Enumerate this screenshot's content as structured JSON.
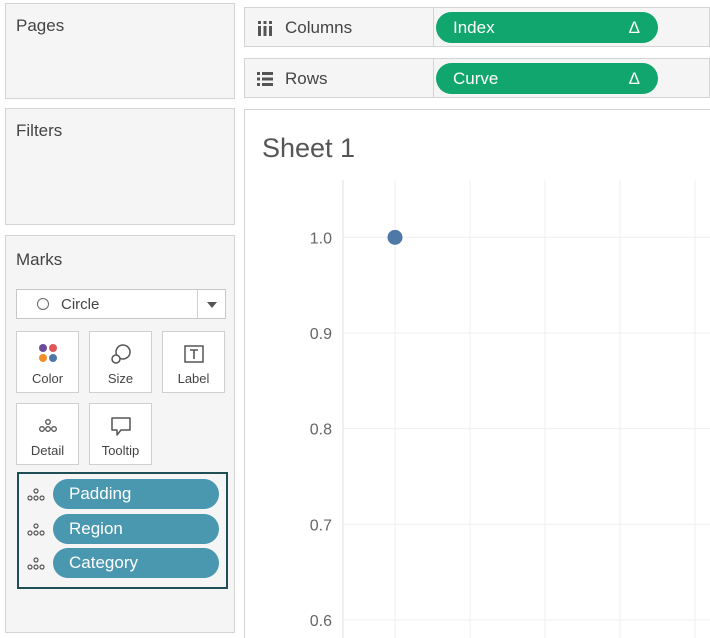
{
  "cards": {
    "pages": "Pages",
    "filters": "Filters",
    "marks": "Marks"
  },
  "marks": {
    "type": "Circle",
    "buttons": {
      "color": "Color",
      "size": "Size",
      "label": "Label",
      "detail": "Detail",
      "tooltip": "Tooltip"
    },
    "detail_fields": [
      "Padding",
      "Region",
      "Category"
    ]
  },
  "shelves": {
    "columns": {
      "label": "Columns",
      "pill": "Index",
      "delta": "Δ"
    },
    "rows": {
      "label": "Rows",
      "pill": "Curve",
      "delta": "Δ"
    }
  },
  "sheet": {
    "title": "Sheet 1"
  },
  "colors": {
    "dimension_pill": "#4a97b0",
    "measure_pill": "#10a66d",
    "mark": "#4e79a7",
    "highlight_border": "#1f4e55"
  },
  "chart_data": {
    "type": "scatter",
    "title": "Sheet 1",
    "xlabel": "",
    "ylabel": "",
    "y_ticks": [
      "1.0",
      "0.9",
      "0.8",
      "0.7",
      "0.6"
    ],
    "y_tick_values": [
      1.0,
      0.9,
      0.8,
      0.7,
      0.6
    ],
    "ylim": [
      0.58,
      1.06
    ],
    "points": [
      {
        "y": 1.0
      }
    ],
    "grid": true
  }
}
